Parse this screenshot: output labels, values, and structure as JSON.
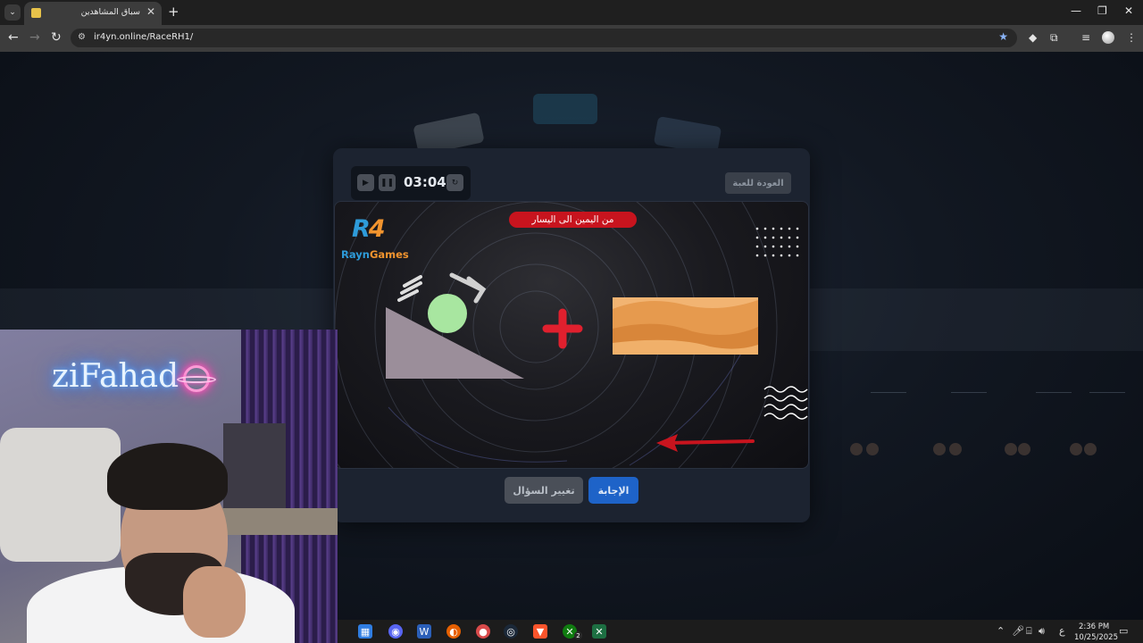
{
  "browser": {
    "tab_title": "سباق المشاهدين",
    "tab_close": "✕",
    "new_tab": "+",
    "url": "ir4yn.online/RaceRH1/",
    "window_controls": {
      "minimize": "—",
      "maximize": "❐",
      "close": "✕"
    }
  },
  "game": {
    "timer": "03:04",
    "back_button": "العودة للعبة",
    "question_banner": "من اليمين الى اليسار",
    "logo_mark_a": "R",
    "logo_mark_b": "4",
    "logo_name_a": "Rayn",
    "logo_name_b": "Games",
    "answer_button": "الإجابة",
    "change_question_button": "تغيير السؤال",
    "picture_items": [
      "slope-with-rolling-ball",
      "plus-sign",
      "desert-sand-dunes"
    ],
    "colors": {
      "banner": "#c8141e",
      "answer": "#1e63c8",
      "ball": "#a8e6a0",
      "plus": "#e0202e"
    }
  },
  "webcam": {
    "neon_sign": "ziFahad"
  },
  "taskbar": {
    "language": "ع",
    "time": "2:36 PM",
    "date": "10/25/2025",
    "apps": [
      "files-icon",
      "discord-icon",
      "word-icon",
      "firefox-icon",
      "game-icon",
      "steam-icon",
      "brave-icon",
      "xbox-icon",
      "excel-icon"
    ],
    "xbox_badge": "2"
  }
}
